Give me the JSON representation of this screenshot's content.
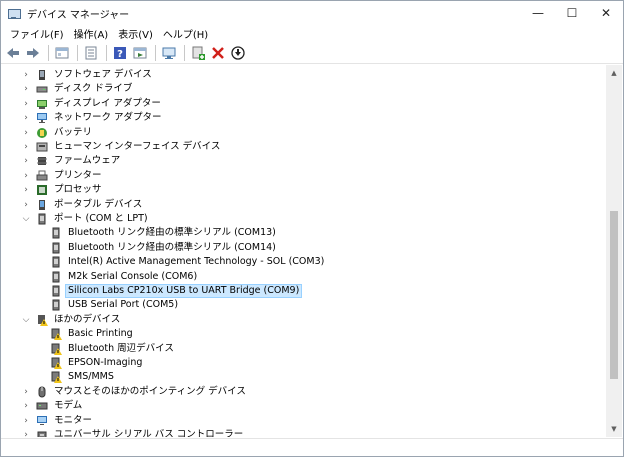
{
  "window": {
    "title": "デバイス マネージャー",
    "controls": {
      "minimize": "—",
      "maximize": "☐",
      "close": "✕"
    }
  },
  "menu": [
    {
      "label": "ファイル(F)"
    },
    {
      "label": "操作(A)"
    },
    {
      "label": "表示(V)"
    },
    {
      "label": "ヘルプ(H)"
    }
  ],
  "toolbar": [
    "back-arrow-icon",
    "forward-arrow-icon",
    "sep",
    "properties-panel-icon",
    "sep",
    "device-list-icon",
    "sep",
    "help-icon",
    "action-panel-icon",
    "sep",
    "monitor-scan-icon",
    "sep",
    "add-driver-icon",
    "uninstall-x-icon",
    "download-circle-icon"
  ],
  "tree": [
    {
      "label": "ソフトウェア デバイス",
      "level": 0,
      "expander": "collapsed",
      "icon": "software-device-icon"
    },
    {
      "label": "ディスク ドライブ",
      "level": 0,
      "expander": "collapsed",
      "icon": "disk-drive-icon"
    },
    {
      "label": "ディスプレイ アダプター",
      "level": 0,
      "expander": "collapsed",
      "icon": "display-adapter-icon"
    },
    {
      "label": "ネットワーク アダプター",
      "level": 0,
      "expander": "collapsed",
      "icon": "network-adapter-icon"
    },
    {
      "label": "バッテリ",
      "level": 0,
      "expander": "collapsed",
      "icon": "battery-icon"
    },
    {
      "label": "ヒューマン インターフェイス デバイス",
      "level": 0,
      "expander": "collapsed",
      "icon": "hid-icon"
    },
    {
      "label": "ファームウェア",
      "level": 0,
      "expander": "collapsed",
      "icon": "firmware-icon"
    },
    {
      "label": "プリンター",
      "level": 0,
      "expander": "collapsed",
      "icon": "printer-icon"
    },
    {
      "label": "プロセッサ",
      "level": 0,
      "expander": "collapsed",
      "icon": "processor-icon"
    },
    {
      "label": "ポータブル デバイス",
      "level": 0,
      "expander": "collapsed",
      "icon": "portable-device-icon"
    },
    {
      "label": "ポート (COM と LPT)",
      "level": 0,
      "expander": "expanded",
      "icon": "port-icon"
    },
    {
      "label": "Bluetooth リンク経由の標準シリアル (COM13)",
      "level": 1,
      "expander": "none",
      "icon": "port-icon"
    },
    {
      "label": "Bluetooth リンク経由の標準シリアル (COM14)",
      "level": 1,
      "expander": "none",
      "icon": "port-icon"
    },
    {
      "label": "Intel(R) Active Management Technology - SOL (COM3)",
      "level": 1,
      "expander": "none",
      "icon": "port-icon"
    },
    {
      "label": "M2k Serial Console (COM6)",
      "level": 1,
      "expander": "none",
      "icon": "port-icon"
    },
    {
      "label": "Silicon Labs CP210x USB to UART Bridge (COM9)",
      "level": 1,
      "expander": "none",
      "icon": "port-icon",
      "selected": true
    },
    {
      "label": "USB Serial Port (COM5)",
      "level": 1,
      "expander": "none",
      "icon": "port-icon"
    },
    {
      "label": "ほかのデバイス",
      "level": 0,
      "expander": "expanded",
      "icon": "other-device-warning-icon"
    },
    {
      "label": "Basic Printing",
      "level": 1,
      "expander": "none",
      "icon": "unknown-device-warning-icon"
    },
    {
      "label": "Bluetooth 周辺デバイス",
      "level": 1,
      "expander": "none",
      "icon": "unknown-device-warning-icon"
    },
    {
      "label": "EPSON-Imaging",
      "level": 1,
      "expander": "none",
      "icon": "unknown-device-warning-icon"
    },
    {
      "label": "SMS/MMS",
      "level": 1,
      "expander": "none",
      "icon": "unknown-device-warning-icon"
    },
    {
      "label": "マウスとそのほかのポインティング デバイス",
      "level": 0,
      "expander": "collapsed",
      "icon": "mouse-icon"
    },
    {
      "label": "モデム",
      "level": 0,
      "expander": "collapsed",
      "icon": "modem-icon"
    },
    {
      "label": "モニター",
      "level": 0,
      "expander": "collapsed",
      "icon": "monitor-icon"
    },
    {
      "label": "ユニバーサル シリアル バス コントローラー",
      "level": 0,
      "expander": "collapsed",
      "icon": "usb-controller-icon"
    }
  ],
  "colors": {
    "selection_bg": "#cce8ff",
    "selection_border": "#99d1ff",
    "scroll_track": "#f0f0f0",
    "scroll_thumb": "#c1c1c1"
  }
}
